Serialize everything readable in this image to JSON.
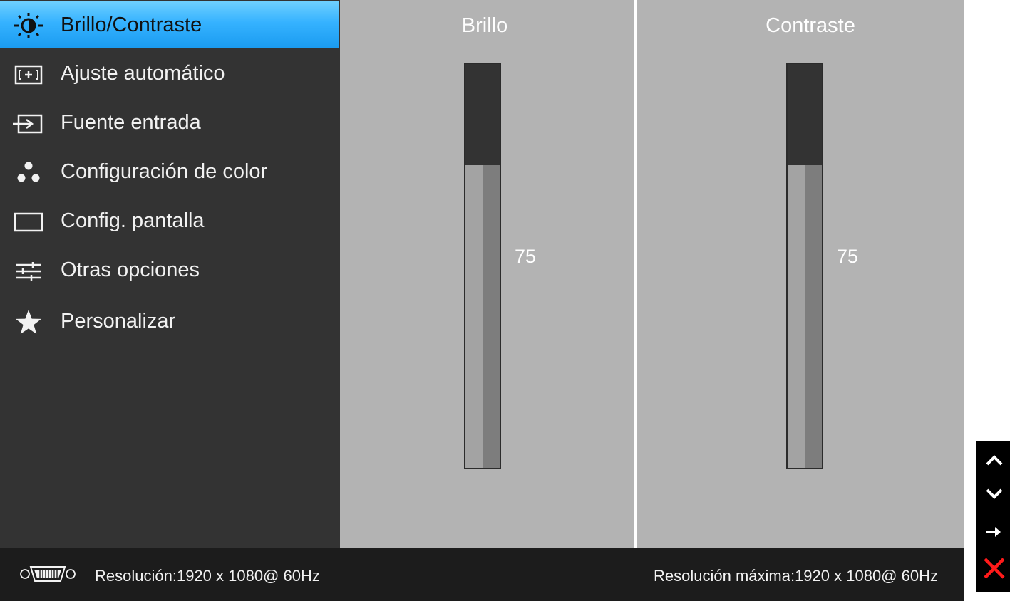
{
  "menu": {
    "items": [
      {
        "label": "Brillo/Contraste",
        "icon": "brightness-contrast-icon",
        "active": true
      },
      {
        "label": "Ajuste  automático",
        "icon": "auto-adjust-icon",
        "active": false
      },
      {
        "label": "Fuente entrada",
        "icon": "input-source-icon",
        "active": false
      },
      {
        "label": "Configuración de color",
        "icon": "color-settings-icon",
        "active": false
      },
      {
        "label": "Config. pantalla",
        "icon": "display-settings-icon",
        "active": false
      },
      {
        "label": "Otras opciones",
        "icon": "other-settings-icon",
        "active": false
      },
      {
        "label": "Personalizar",
        "icon": "star-icon",
        "active": false
      }
    ]
  },
  "brightness": {
    "title": "Brillo",
    "value": 75,
    "value_text": "75",
    "max": 100
  },
  "contrast": {
    "title": "Contraste",
    "value": 75,
    "value_text": "75",
    "max": 100
  },
  "status": {
    "connector_icon": "vga-connector-icon",
    "resolution": "Resolución:1920 x 1080@ 60Hz",
    "max_resolution": "Resolución máxima:1920 x 1080@ 60Hz"
  },
  "keys": [
    {
      "icon": "up-arrow-icon"
    },
    {
      "icon": "down-arrow-icon"
    },
    {
      "icon": "enter-arrow-icon"
    },
    {
      "icon": "close-icon",
      "color": "#ff1a1a"
    }
  ],
  "colors": {
    "highlight": "#35b2ff",
    "sidebar": "#333333",
    "panel": "#b3b3b3"
  }
}
